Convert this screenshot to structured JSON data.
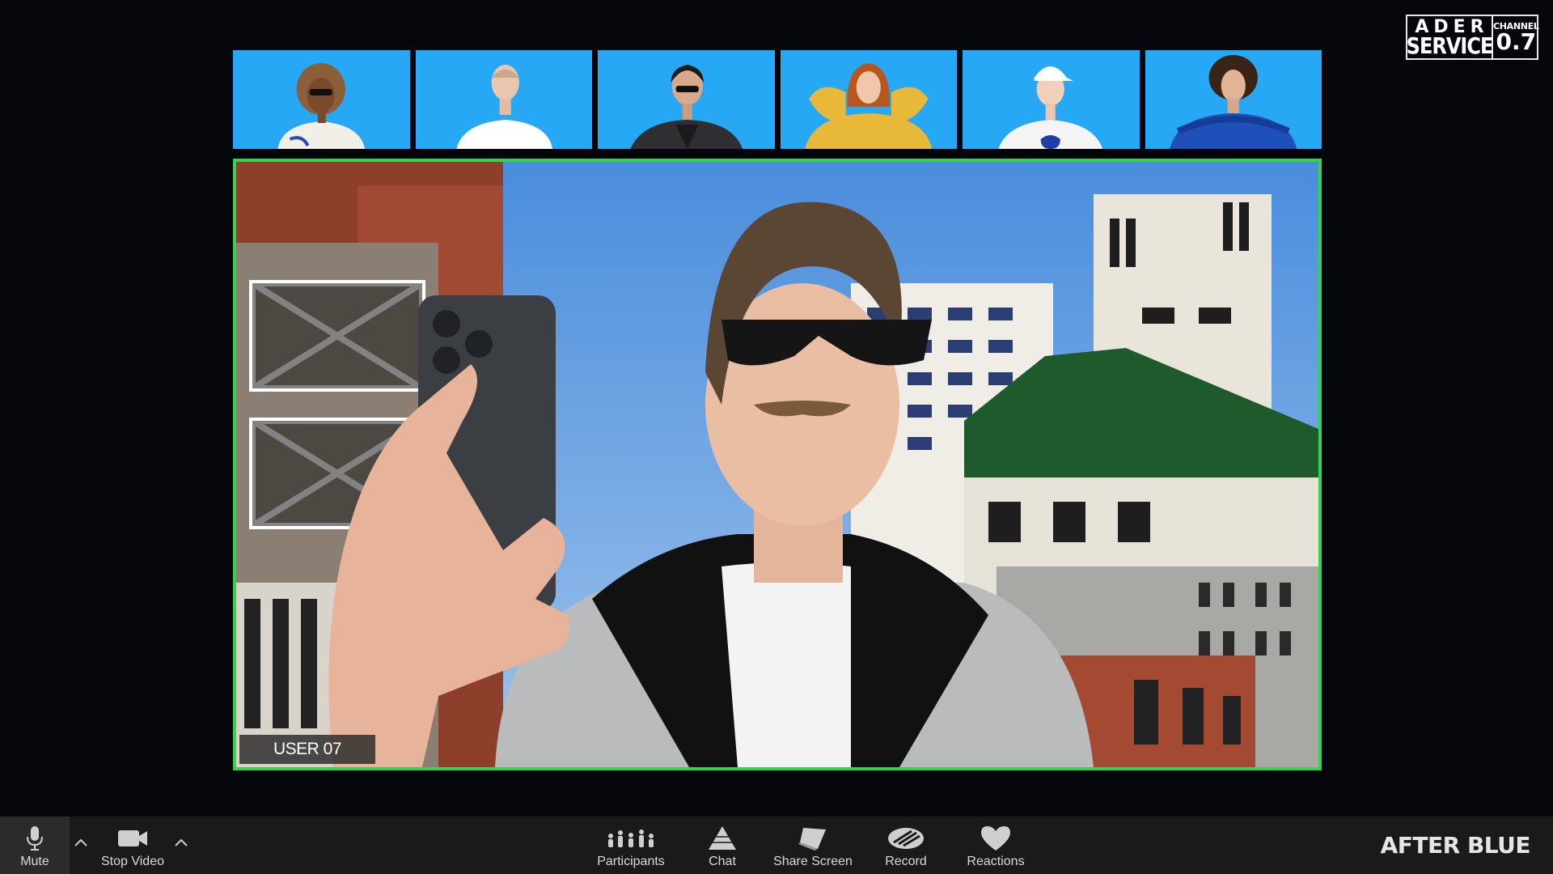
{
  "brand": {
    "line1": "ADER",
    "line2": "SERVICE",
    "channel_label": "CHANNEL",
    "channel_number": "0.7"
  },
  "participants": [
    {
      "icon": "participant-thumbnail-1",
      "hair": "#6b4a2a",
      "shirt": "#f2efe8"
    },
    {
      "icon": "participant-thumbnail-2",
      "hair": "#c9a78c",
      "shirt": "#ffffff"
    },
    {
      "icon": "participant-thumbnail-3",
      "hair": "#1b1b1b",
      "shirt": "#2f2f33"
    },
    {
      "icon": "participant-thumbnail-4",
      "hair": "#b8561f",
      "shirt": "#e8b83a"
    },
    {
      "icon": "participant-thumbnail-5",
      "hair": "#ffffff",
      "shirt": "#f4f4f4"
    },
    {
      "icon": "participant-thumbnail-6",
      "hair": "#3a2416",
      "shirt": "#1f4fb8"
    }
  ],
  "main_video": {
    "user_label": "USER 07",
    "active_border_color": "#35d24f"
  },
  "toolbar": {
    "mute_label": "Mute",
    "stop_video_label": "Stop Video",
    "participants_label": "Participants",
    "chat_label": "Chat",
    "share_screen_label": "Share Screen",
    "record_label": "Record",
    "reactions_label": "Reactions"
  },
  "footer_brand": "AFTER BLUE",
  "colors": {
    "thumbnail_background": "#27a8f4",
    "toolbar_background": "#1a1a1a",
    "page_background": "#05070c"
  }
}
